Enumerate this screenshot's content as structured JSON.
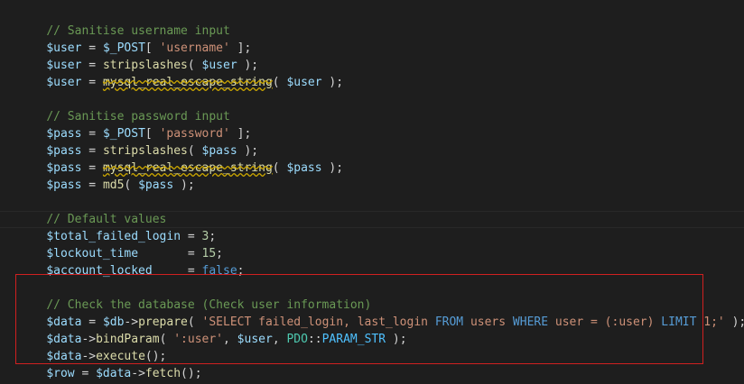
{
  "code": {
    "l1": {
      "comment": "// Sanitise username input"
    },
    "l2": {
      "v": "$user",
      "eq": " = ",
      "post": "$_POST",
      "b1": "[ ",
      "s": "'username'",
      "b2": " ];"
    },
    "l3": {
      "v": "$user",
      "eq": " = ",
      "fn": "stripslashes",
      "p1": "( ",
      "a": "$user",
      "p2": " );"
    },
    "l4": {
      "v": "$user",
      "eq": " = ",
      "fn": "mysql_real_escape_string",
      "p1": "( ",
      "a": "$user",
      "p2": " );"
    },
    "l6": {
      "comment": "// Sanitise password input"
    },
    "l7": {
      "v": "$pass",
      "eq": " = ",
      "post": "$_POST",
      "b1": "[ ",
      "s": "'password'",
      "b2": " ];"
    },
    "l8": {
      "v": "$pass",
      "eq": " = ",
      "fn": "stripslashes",
      "p1": "( ",
      "a": "$pass",
      "p2": " );"
    },
    "l9": {
      "v": "$pass",
      "eq": " = ",
      "fn": "mysql_real_escape_string",
      "p1": "( ",
      "a": "$pass",
      "p2": " );"
    },
    "l10": {
      "v": "$pass",
      "eq": " = ",
      "fn": "md5",
      "p1": "( ",
      "a": "$pass",
      "p2": " );"
    },
    "l12": {
      "comment": "// Default values"
    },
    "l13": {
      "v": "$total_failed_login",
      "eq": " = ",
      "val": "3",
      "end": ";"
    },
    "l14": {
      "v": "$lockout_time",
      "pad": "       ",
      "eq": "= ",
      "val": "15",
      "end": ";"
    },
    "l15": {
      "v": "$account_locked",
      "pad": "     ",
      "eq": "= ",
      "val": "false",
      "end": ";"
    },
    "l17": {
      "comment": "// Check the database (Check user information)"
    },
    "l18": {
      "v": "$data",
      "eq": " = ",
      "obj": "$db",
      "arrow": "->",
      "fn": "prepare",
      "p1": "( ",
      "s1": "'SELECT failed_login, last_login ",
      "k1": "FROM",
      "s2": " users ",
      "k2": "WHERE",
      "s3": " user = (:user) ",
      "k3": "LIMIT",
      "s4": " 1;'",
      "p2": " );"
    },
    "l19": {
      "obj": "$data",
      "arrow": "->",
      "fn": "bindParam",
      "p1": "( ",
      "s": "':user'",
      "c1": ", ",
      "a": "$user",
      "c2": ", ",
      "cls": "PDO",
      "dc": "::",
      "const": "PARAM_STR",
      "p2": " );"
    },
    "l20": {
      "obj": "$data",
      "arrow": "->",
      "fn": "execute",
      "p": "();"
    },
    "l21": {
      "v": "$row",
      "eq": " = ",
      "obj": "$data",
      "arrow": "->",
      "fn": "fetch",
      "p": "();"
    }
  }
}
